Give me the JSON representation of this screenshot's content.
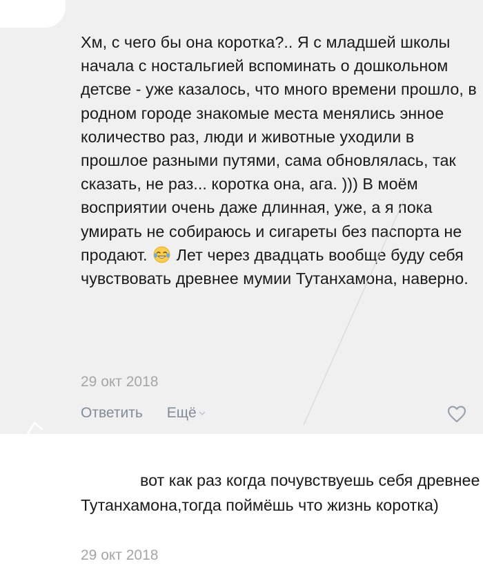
{
  "comment": {
    "text_before_emoji": "Хм, с чего бы она коротка?.. Я с младшей школы начала с ностальгией вспоминать о дошкольном детсве - уже казалось, что много времени прошло, в родном городе знакомые места менялись энное количество раз, люди и животные уходили в прошлое разными путями, сама обновлялась, так сказать, не раз... коротка она, ага. ))) В моём восприятии очень даже длинная, уже, а я пока умирать не собираюсь и сигареты без паспорта не продают.",
    "emoji_icon": "face-with-tears-of-joy-icon",
    "text_after_emoji": "Лет через двадцать вообще буду себя чувствовать древнее мумии Тутанхамона, наверно.",
    "date": "29 окт 2018"
  },
  "actions": {
    "reply_label": "Ответить",
    "more_label": "Ещё"
  },
  "reply": {
    "text": "вот как раз когда почувствуешь себя древнее Тутанхамона,тогда поймёшь что жизнь коротка)",
    "date": "29 окт 2018"
  },
  "colors": {
    "text": "#1a1a1a",
    "secondary": "#818c99",
    "date": "#a6a6a6",
    "panel_bg": "#f0f0f0"
  }
}
